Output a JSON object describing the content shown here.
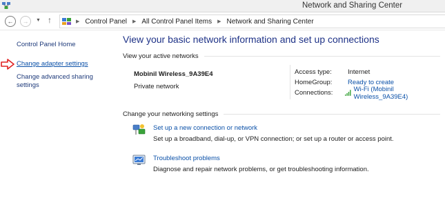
{
  "window": {
    "title": "Network and Sharing Center",
    "app_icon": "network-sharing-icon"
  },
  "addressbar": {
    "back_icon": "back-arrow-icon",
    "forward_icon": "forward-arrow-icon",
    "recent_icon": "chevron-down-icon",
    "up_icon": "up-arrow-icon",
    "breadcrumbs": [
      "Control Panel",
      "All Control Panel Items",
      "Network and Sharing Center"
    ]
  },
  "sidebar": {
    "home": "Control Panel Home",
    "items": [
      {
        "label": "Change adapter settings",
        "highlighted": true
      },
      {
        "label": "Change advanced sharing settings"
      }
    ],
    "pointer_icon": "red-arrow-icon",
    "pointer_color": "#e02020"
  },
  "main": {
    "heading": "View your basic network information and set up connections",
    "active_networks_header": "View your active networks",
    "network": {
      "name": "Mobinil Wireless_9A39E4",
      "type": "Private network",
      "access_type_label": "Access type:",
      "access_type_value": "Internet",
      "homegroup_label": "HomeGroup:",
      "homegroup_value": "Ready to create",
      "connections_label": "Connections:",
      "connections_value": "Wi-Fi (Mobinil Wireless_9A39E4)",
      "wifi_icon": "wifi-signal-icon"
    },
    "settings_header": "Change your networking settings",
    "tasks": [
      {
        "icon": "network-setup-icon",
        "link": "Set up a new connection or network",
        "description": "Set up a broadband, dial-up, or VPN connection; or set up a router or access point."
      },
      {
        "icon": "troubleshoot-icon",
        "link": "Troubleshoot problems",
        "description": "Diagnose and repair network problems, or get troubleshooting information."
      }
    ]
  },
  "colors": {
    "link": "#0a50a8",
    "heading": "#1e3287",
    "titlebar": "#f0f0f0"
  }
}
